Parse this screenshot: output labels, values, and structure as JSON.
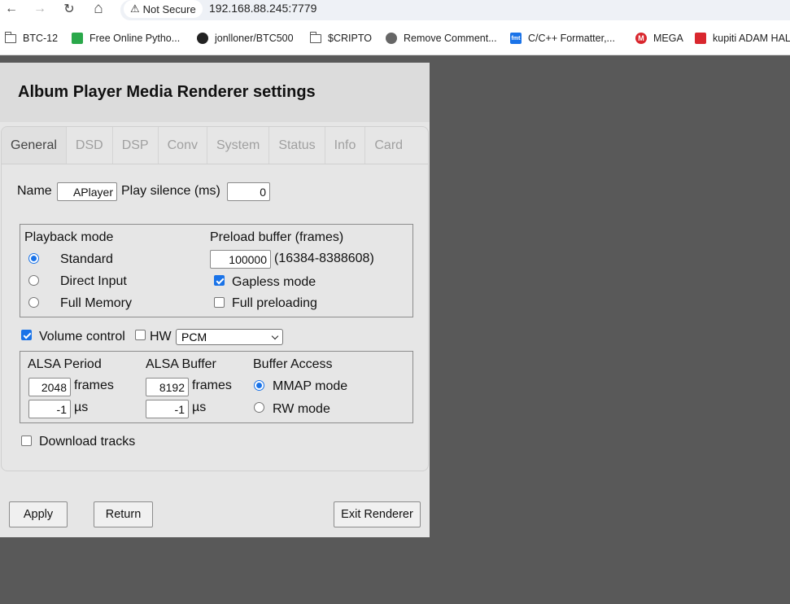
{
  "browser": {
    "back_icon": "←",
    "forward_icon": "→",
    "reload_icon": "↻",
    "home_icon": "⌂",
    "security_label": "Not Secure",
    "url": "192.168.88.245:7779",
    "bookmarks": [
      {
        "label": "BTC-12"
      },
      {
        "label": "Free Online Pytho..."
      },
      {
        "label": "jonlloner/BTC500"
      },
      {
        "label": "$CRIPTO"
      },
      {
        "label": "Remove Comment..."
      },
      {
        "label": "C/C++ Formatter,..."
      },
      {
        "label": "MEGA"
      },
      {
        "label": "kupiti ADAM HAL"
      }
    ],
    "bookmark_icon_text": {
      "fmt": "fmt",
      "mega": "M"
    }
  },
  "panel": {
    "title": "Album Player Media Renderer settings",
    "tabs": [
      "General",
      "DSD",
      "DSP",
      "Conv",
      "System",
      "Status",
      "Info",
      "Card"
    ],
    "active_tab": "General",
    "name_label": "Name",
    "name_value": "APlayer",
    "play_silence_label": "Play silence (ms)",
    "play_silence_value": "0",
    "playback": {
      "title": "Playback mode",
      "options": [
        "Standard",
        "Direct Input",
        "Full Memory"
      ],
      "selected": "Standard"
    },
    "preload": {
      "title": "Preload buffer (frames)",
      "value": "100000",
      "range": "(16384-8388608)",
      "gapless_label": "Gapless mode",
      "gapless_checked": true,
      "full_preload_label": "Full preloading",
      "full_preload_checked": false
    },
    "volume": {
      "label": "Volume control",
      "checked": true,
      "hw_label": "HW",
      "hw_checked": false,
      "format_selected": "PCM"
    },
    "alsa": {
      "period_title": "ALSA Period",
      "period_frames": "2048",
      "period_us": "-1",
      "buffer_title": "ALSA Buffer",
      "buffer_frames": "8192",
      "buffer_us": "-1",
      "frames_unit": "frames",
      "us_unit": "µs",
      "access_title": "Buffer Access",
      "mmap_label": "MMAP mode",
      "rw_label": "RW mode",
      "selected_access": "MMAP mode"
    },
    "download_label": "Download tracks",
    "download_checked": false,
    "buttons": {
      "apply": "Apply",
      "return": "Return",
      "exit": "Exit Renderer"
    }
  }
}
